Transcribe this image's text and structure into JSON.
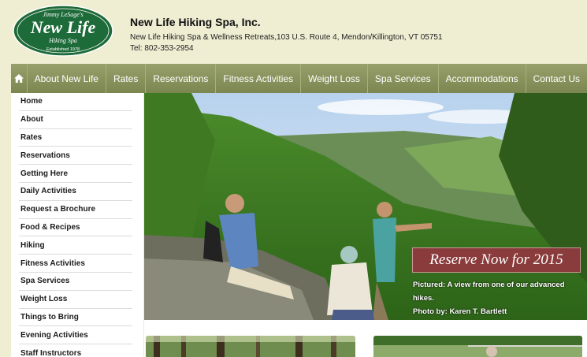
{
  "logo": {
    "top_text": "Jimmy LeSage's",
    "main_text": "New Life",
    "sub_text": "Hiking Spa",
    "est_text": "Established 1978"
  },
  "header": {
    "name": "New Life Hiking Spa, Inc.",
    "address": "New Life Hiking Spa & Wellness Retreats,103 U.S. Route 4, Mendon/Killington, VT 05751",
    "tel": "Tel: 802-353-2954"
  },
  "nav": {
    "home_icon": "home-icon",
    "items": [
      "About New Life",
      "Rates",
      "Reservations",
      "Fitness Activities",
      "Weight Loss",
      "Spa Services",
      "Accommodations",
      "Contact Us"
    ]
  },
  "sidebar": {
    "items": [
      "Home",
      "About",
      "Rates",
      "Reservations",
      "Getting Here",
      "Daily Activities",
      "Request a Brochure",
      "Food & Recipes",
      "Hiking",
      "Fitness Activities",
      "Spa Services",
      "Weight Loss",
      "Things to Bring",
      "Evening Activities",
      "Staff Instructors"
    ]
  },
  "hero": {
    "badge": "Reserve Now for 2015",
    "caption_line1": "Pictured:  A view from one of our advanced hikes.",
    "caption_line2": "Photo by: Karen T. Bartlett"
  },
  "colors": {
    "background": "#efedd2",
    "nav": "#8a9360",
    "logo_green": "#1e6b3a",
    "badge": "#8a3b3b"
  }
}
